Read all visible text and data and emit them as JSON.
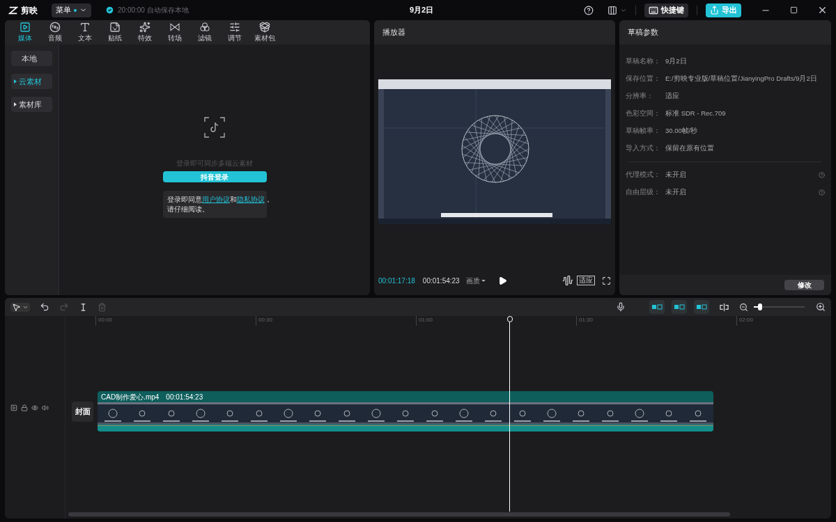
{
  "app": {
    "name": "剪映",
    "menu_label": "菜单",
    "autosave": "20:00:00 自动保存本地",
    "title": "9月2日",
    "shortcut_label": "快捷键",
    "export_label": "导出"
  },
  "media_tabs": [
    {
      "label": "媒体",
      "selected": true
    },
    {
      "label": "音频",
      "selected": false
    },
    {
      "label": "文本",
      "selected": false
    },
    {
      "label": "贴纸",
      "selected": false
    },
    {
      "label": "特效",
      "selected": false
    },
    {
      "label": "转场",
      "selected": false
    },
    {
      "label": "滤镜",
      "selected": false
    },
    {
      "label": "调节",
      "selected": false
    },
    {
      "label": "素材包",
      "selected": false
    }
  ],
  "sidebar": {
    "items": [
      {
        "label": "本地",
        "selected": false,
        "expandable": false
      },
      {
        "label": "云素材",
        "selected": true,
        "expandable": true
      },
      {
        "label": "素材库",
        "selected": false,
        "expandable": true
      }
    ]
  },
  "cloud_login": {
    "hint": "登录即可同步多端云素材",
    "button": "抖音登录",
    "agreement": "登录即同意",
    "user_link": "用户协议",
    "and": "和",
    "privacy_link": "隐私协议",
    "tail": "，",
    "line2": "请仔细阅读。"
  },
  "player": {
    "title": "播放器",
    "current_time": "00:01:17:18",
    "total_time": "00:01:54:23",
    "quality": "画质",
    "fit": "适应"
  },
  "draft": {
    "title": "草稿参数",
    "params": [
      {
        "label": "草稿名称：",
        "value": "9月2日"
      },
      {
        "label": "保存位置：",
        "value": "E:/剪映专业版/草稿位置/JianyingPro Drafts/9月2日"
      },
      {
        "label": "分辨率：",
        "value": "适应"
      },
      {
        "label": "色彩空间：",
        "value": "标准 SDR - Rec.709"
      },
      {
        "label": "草稿帧率：",
        "value": "30.00帧/秒"
      },
      {
        "label": "导入方式：",
        "value": "保留在原有位置"
      }
    ],
    "options": [
      {
        "label": "代理模式：",
        "value": "未开启"
      },
      {
        "label": "自由层级：",
        "value": "未开启"
      }
    ],
    "edit_button": "修改"
  },
  "timeline": {
    "toggles": [
      {
        "on": true
      },
      {
        "on": true
      },
      {
        "on": true
      }
    ],
    "zoom": {
      "level": 0.12
    },
    "ruler": [
      "00:00",
      "00:30",
      "01:00",
      "01:30",
      "02:00"
    ],
    "cover": "封面",
    "clip": {
      "name": "CAD制作爱心.mp4",
      "duration": "00:01:54:23"
    }
  }
}
